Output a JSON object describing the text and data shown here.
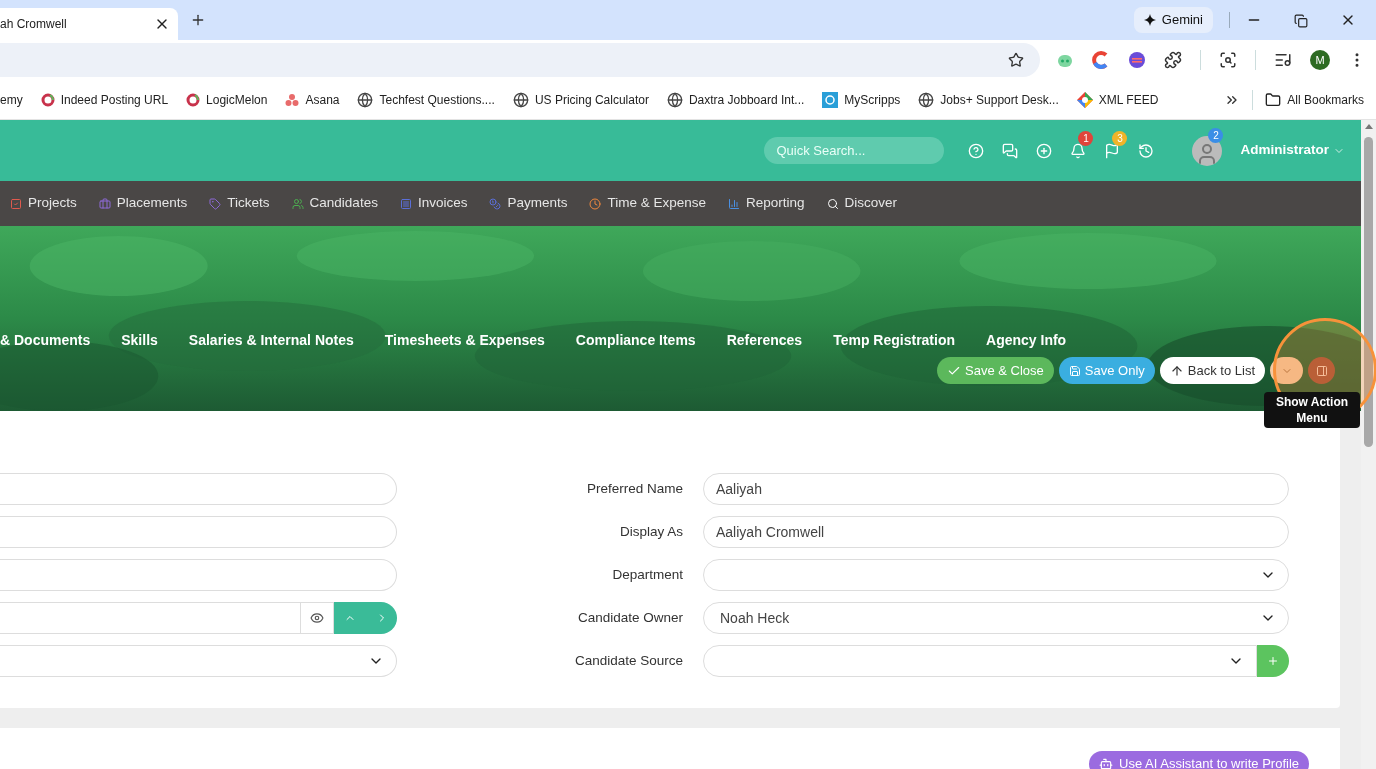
{
  "browser": {
    "tab_title": "ah Cromwell",
    "gemini": "Gemini",
    "profile_initial": "M",
    "bookmarks": [
      {
        "label": "emy"
      },
      {
        "label": "Indeed Posting URL"
      },
      {
        "label": "LogicMelon"
      },
      {
        "label": "Asana"
      },
      {
        "label": "Techfest Questions...."
      },
      {
        "label": "US Pricing Calculator"
      },
      {
        "label": "Daxtra Jobboard Int..."
      },
      {
        "label": "MyScripps"
      },
      {
        "label": "Jobs+ Support Desk..."
      },
      {
        "label": "XML FEED"
      }
    ],
    "all_bookmarks": "All Bookmarks"
  },
  "header": {
    "search_placeholder": "Quick Search...",
    "notification_count": "1",
    "flag_count": "3",
    "avatar_badge": "2",
    "user": "Administrator"
  },
  "nav": [
    {
      "label": "Projects"
    },
    {
      "label": "Placements"
    },
    {
      "label": "Tickets"
    },
    {
      "label": "Candidates"
    },
    {
      "label": "Invoices"
    },
    {
      "label": "Payments"
    },
    {
      "label": "Time & Expense"
    },
    {
      "label": "Reporting"
    },
    {
      "label": "Discover"
    }
  ],
  "record_tabs": [
    "& Documents",
    "Skills",
    "Salaries & Internal Notes",
    "Timesheets & Expenses",
    "Compliance Items",
    "References",
    "Temp Registration",
    "Agency Info"
  ],
  "actions": [
    {
      "kind": "save_close",
      "label": "Save & Close"
    },
    {
      "kind": "save",
      "label": "Save Only"
    },
    {
      "kind": "back",
      "label": "Back to List"
    },
    {
      "kind": "dropdown"
    },
    {
      "kind": "panel"
    }
  ],
  "tooltip": "Show Action Menu",
  "form_left": [
    {
      "kind": "text"
    },
    {
      "kind": "text"
    },
    {
      "kind": "text"
    },
    {
      "kind": "text_buttons"
    },
    {
      "kind": "select"
    }
  ],
  "form_right": [
    {
      "label": "Preferred Name",
      "kind": "text",
      "value": "Aaliyah"
    },
    {
      "label": "Display As",
      "kind": "text",
      "value": "Aaliyah Cromwell"
    },
    {
      "label": "Department",
      "kind": "select"
    },
    {
      "label": "Candidate Owner",
      "kind": "select",
      "value": "Noah Heck"
    },
    {
      "label": "Candidate Source",
      "kind": "select_add"
    }
  ],
  "ai_button": "Use AI Assistant to write Profile"
}
